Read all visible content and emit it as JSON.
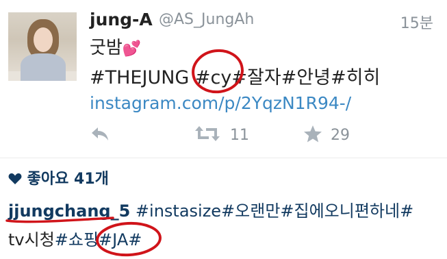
{
  "tweet": {
    "display_name": "jung-A",
    "handle": "@AS_JungAh",
    "time": "15분",
    "text_line1": "굿밤",
    "text_line1_emoji": "💕",
    "hashtags_line": [
      "#THEJUNG ",
      "#cy",
      "#",
      "잘자",
      "#안녕",
      "#히히"
    ],
    "link": "instagram.com/p/2YqzN1R94-/",
    "retweet_count": "11",
    "favorite_count": "29",
    "icons": [
      "reply-icon",
      "retweet-icon",
      "star-icon"
    ]
  },
  "instagram": {
    "likes_label": "좋아요 41개",
    "username": "jjungchang_5",
    "caption_line1": " #instasize#오랜만#집에오니편하네#",
    "caption_line2_plain": "tv시청",
    "caption_line2_tags": "#쇼핑#JA#"
  },
  "annotations": {
    "circle_color": "#d0141a"
  },
  "colors": {
    "link": "#3b88c3",
    "dark_blue": "#123a60",
    "muted": "#8a9299"
  }
}
